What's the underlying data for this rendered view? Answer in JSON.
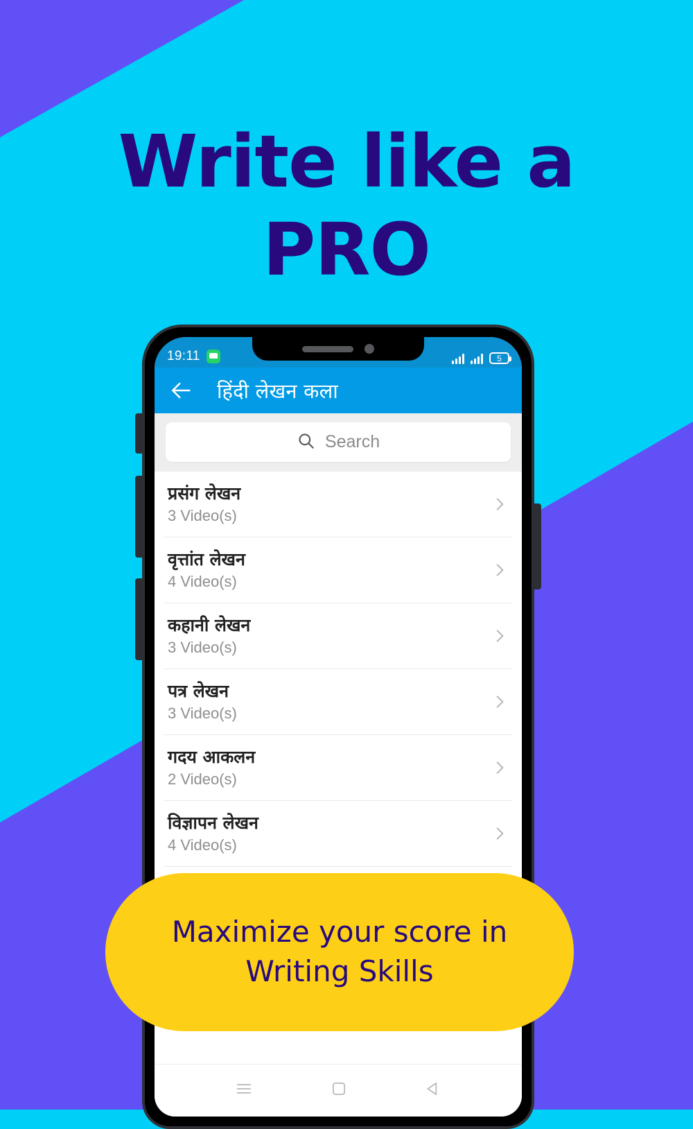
{
  "promo": {
    "headline_line1": "Write like a",
    "headline_line2": "PRO",
    "banner_line1": "Maximize your score in",
    "banner_line2": "Writing Skills",
    "colors": {
      "background_cyan": "#00d0f8",
      "accent_purple": "#6150f5",
      "headline_navy": "#28097e",
      "banner_yellow": "#fdd017",
      "appbar_blue": "#039be5"
    }
  },
  "statusbar": {
    "time": "19:11",
    "chat_icon": "chat-icon",
    "signal_icon_1": "signal-bars-icon",
    "signal_icon_2": "signal-bars-icon",
    "battery_level": "5",
    "battery_icon": "battery-icon"
  },
  "appbar": {
    "back_icon": "back-arrow-icon",
    "title": "हिंदी लेखन कला"
  },
  "search": {
    "icon": "search-icon",
    "placeholder": "Search",
    "value": ""
  },
  "list": {
    "items": [
      {
        "title": "प्रसंग लेखन",
        "subtitle": "3 Video(s)",
        "chevron": "chevron-right-icon"
      },
      {
        "title": "वृत्तांत लेखन",
        "subtitle": "4 Video(s)",
        "chevron": "chevron-right-icon"
      },
      {
        "title": "कहानी लेखन",
        "subtitle": "3 Video(s)",
        "chevron": "chevron-right-icon"
      },
      {
        "title": "पत्र लेखन",
        "subtitle": "3 Video(s)",
        "chevron": "chevron-right-icon"
      },
      {
        "title": "गदय आकलन",
        "subtitle": "2 Video(s)",
        "chevron": "chevron-right-icon"
      },
      {
        "title": "विज्ञापन लेखन",
        "subtitle": "4 Video(s)",
        "chevron": "chevron-right-icon"
      }
    ]
  },
  "navbar": {
    "recents_icon": "menu-icon",
    "home_icon": "square-home-icon",
    "back_icon": "triangle-back-icon"
  }
}
